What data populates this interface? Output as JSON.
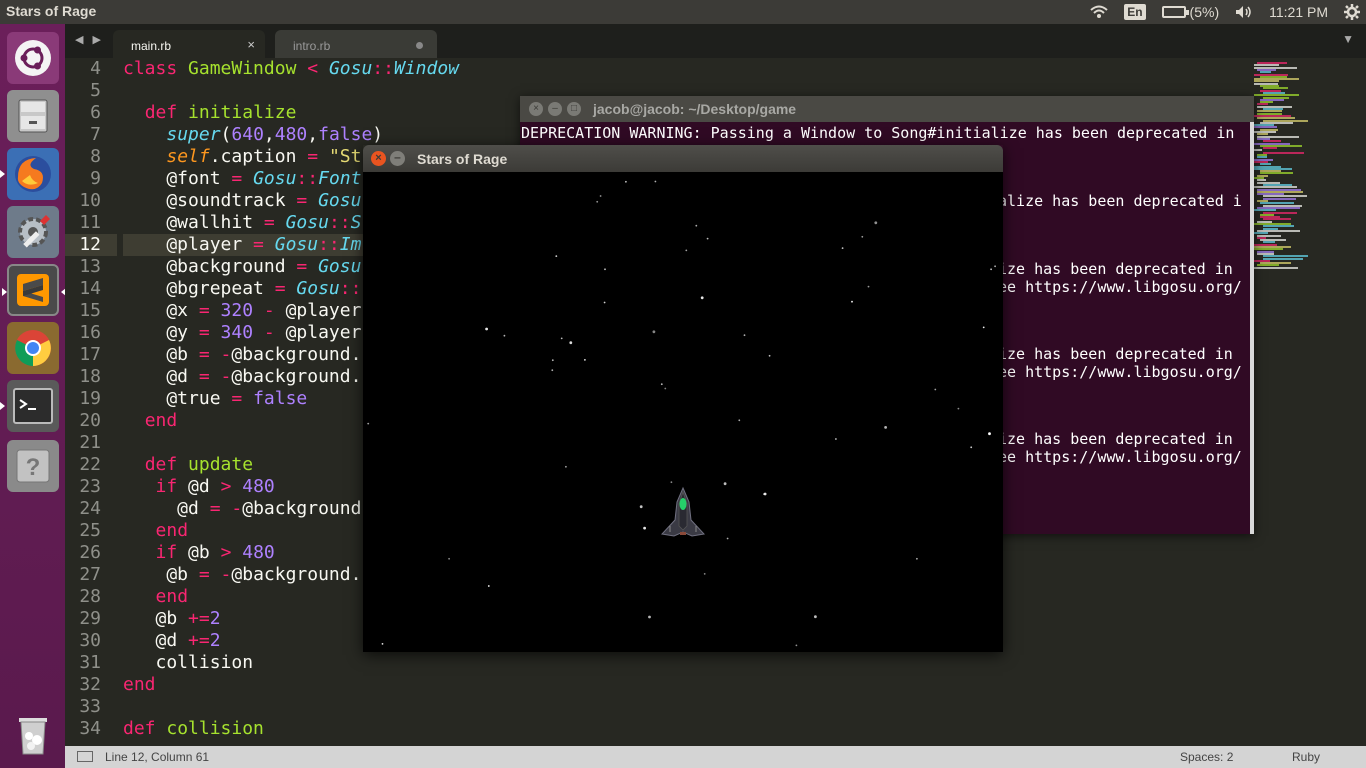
{
  "top_panel": {
    "app_title": "Stars of Rage",
    "keyboard": "En",
    "battery": "(5%)",
    "clock": "11:21 PM",
    "icons": [
      "wifi-icon",
      "keyboard-layout-icon",
      "battery-icon",
      "volume-icon",
      "settings-gear-icon"
    ]
  },
  "launcher": {
    "items": [
      "ubuntu-dash",
      "files",
      "firefox",
      "system-settings",
      "sublime-text",
      "chrome",
      "terminal",
      "help",
      "trash"
    ]
  },
  "editor": {
    "tabs": [
      {
        "label": "main.rb",
        "active": true
      },
      {
        "label": "intro.rb",
        "active": false
      }
    ],
    "gutter": [
      "4",
      "5",
      "6",
      "7",
      "8",
      "9",
      "10",
      "11",
      "12",
      "13",
      "14",
      "15",
      "16",
      "17",
      "18",
      "19",
      "20",
      "21",
      "22",
      "23",
      "24",
      "25",
      "26",
      "27",
      "28",
      "29",
      "30",
      "31",
      "32",
      "33",
      "34"
    ],
    "current_line": "12",
    "status": {
      "position": "Line 12, Column 61",
      "spaces": "Spaces: 2",
      "syntax": "Ruby"
    }
  },
  "terminal": {
    "title": "jacob@jacob: ~/Desktop/game",
    "lines": [
      "DEPRECATION WARNING: Passing a Window to Song#initialize has been deprecated in",
      "alize has been deprecated i",
      "ize has been deprecated in",
      "ee https://www.libgosu.org/",
      "ize has been deprecated in",
      "ee https://www.libgosu.org/",
      "ize has been deprecated in",
      "ee https://www.libgosu.org/"
    ]
  },
  "game": {
    "title": "Stars of Rage",
    "close_glyph": "×",
    "min_glyph": "–"
  },
  "colors": {
    "keyword": "#f92672",
    "function": "#a6e22e",
    "class": "#66d9ef",
    "number": "#ae81ff",
    "string": "#e6db74",
    "terminal_bg": "#300a24",
    "launcher_bg": "#6b1f5a"
  }
}
